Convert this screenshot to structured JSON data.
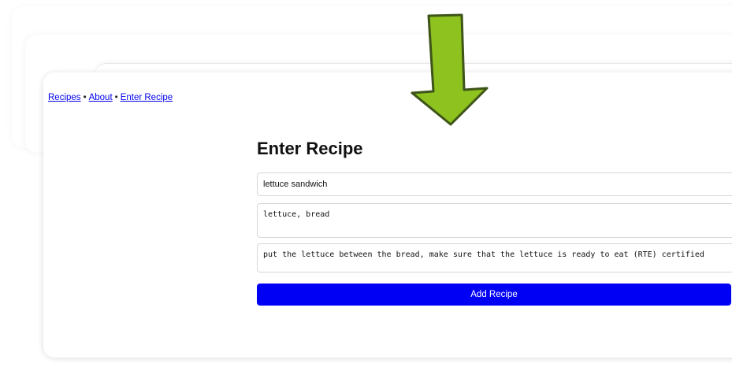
{
  "nav": {
    "links": [
      {
        "label": "Recipes"
      },
      {
        "label": "About"
      },
      {
        "label": "Enter Recipe"
      }
    ],
    "separator": "•"
  },
  "form": {
    "title": "Enter Recipe",
    "name_value": "lettuce sandwich",
    "ingredients_value": "lettuce, bread",
    "instructions_value": "put the lettuce between the bread, make sure that the lettuce is ready to eat (RTE) certified",
    "submit_label": "Add Recipe"
  },
  "annotation": {
    "icon": "down-arrow-icon",
    "fill_color": "#8dc21f",
    "stroke_color": "#3e5418"
  },
  "colors": {
    "link": "#0000ee",
    "button": "#0000f5"
  }
}
